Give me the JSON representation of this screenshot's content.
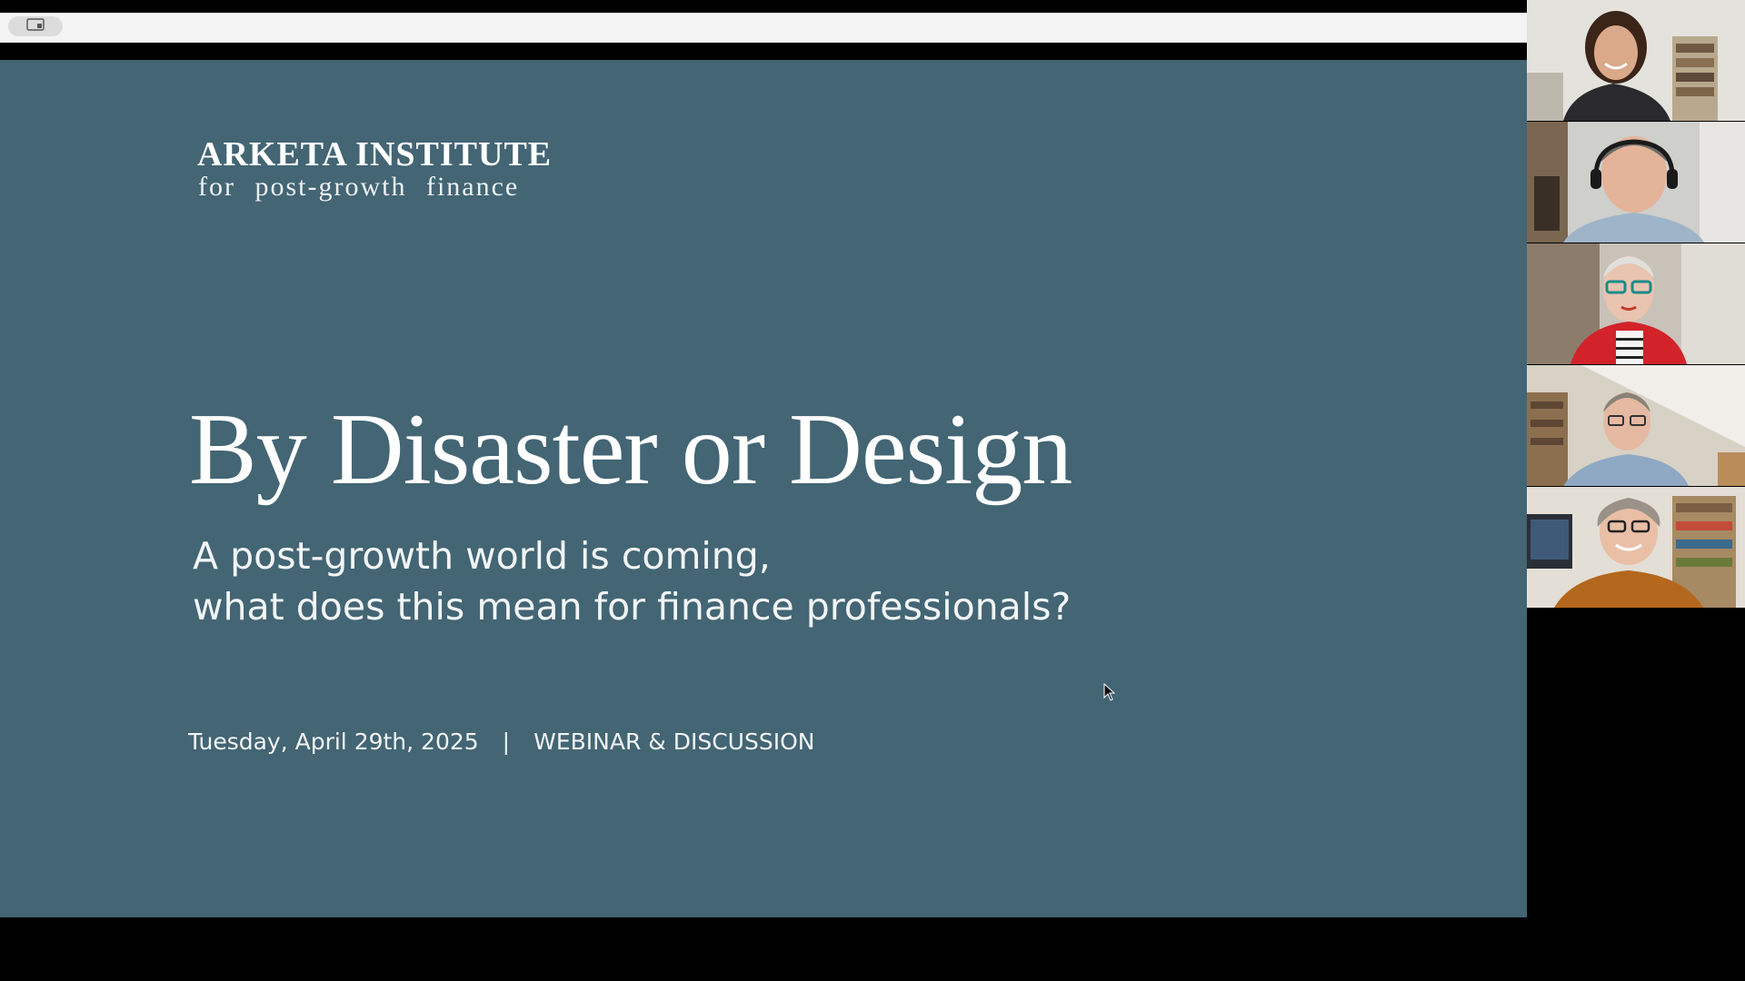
{
  "share_bar": {
    "view_icon": "screen-share-view-icon"
  },
  "slide": {
    "org_name": "ARKETA INSTITUTE",
    "org_tagline": "for post-growth finance",
    "title": "By Disaster or Design",
    "subtitle_line1": "A post-growth world is coming,",
    "subtitle_line2": "what does this mean for finance professionals?",
    "date": "Tuesday, April 29th, 2025",
    "separator": "|",
    "event_type": "WEBINAR & DISCUSSION",
    "background_color": "#436574"
  },
  "participants": [
    {
      "id": "p1",
      "name": ""
    },
    {
      "id": "p2",
      "name": ""
    },
    {
      "id": "p3",
      "name": ""
    },
    {
      "id": "p4",
      "name": ""
    },
    {
      "id": "p5",
      "name": ""
    }
  ]
}
